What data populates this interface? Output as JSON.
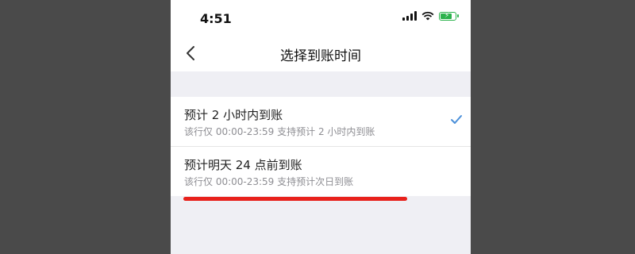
{
  "status_bar": {
    "time": "4:51"
  },
  "nav": {
    "title": "选择到账时间"
  },
  "options": [
    {
      "title": "预计 2 小时内到账",
      "subtitle": "该行仅 00:00-23:59 支持预计 2 小时内到账",
      "selected": true
    },
    {
      "title": "预计明天 24 点前到账",
      "subtitle": "该行仅 00:00-23:59 支持预计次日到账",
      "selected": false
    }
  ],
  "colors": {
    "accent": "#4a8fd9",
    "highlight": "#e8211b",
    "battery": "#2bb24c"
  },
  "icons": [
    "back-chevron-icon",
    "check-icon",
    "signal-icon",
    "wifi-icon",
    "battery-icon"
  ]
}
